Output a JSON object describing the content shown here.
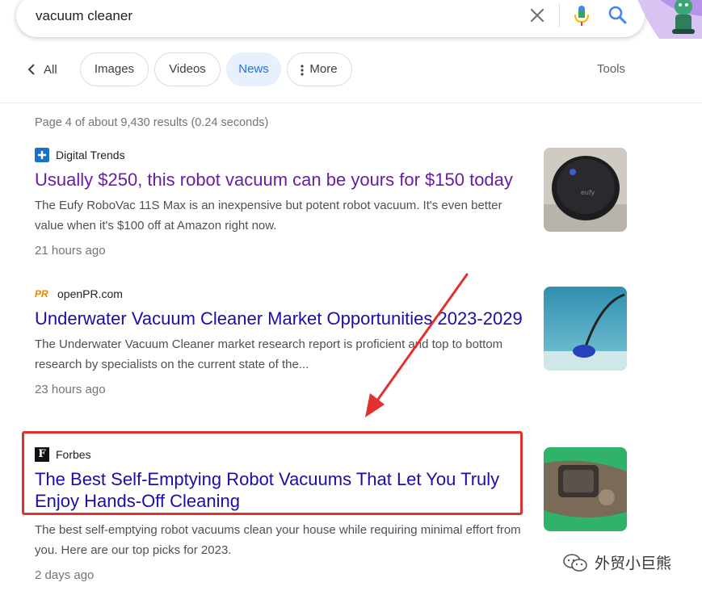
{
  "search": {
    "query": "vacuum cleaner"
  },
  "tabs": {
    "back_label": "All",
    "items": [
      {
        "label": "Images"
      },
      {
        "label": "Videos"
      },
      {
        "label": "News"
      },
      {
        "label": "More"
      }
    ],
    "tools_label": "Tools"
  },
  "stats": "Page 4 of about 9,430 results (0.24 seconds)",
  "results": [
    {
      "source": "Digital Trends",
      "title": "Usually $250, this robot vacuum can be yours for $150 today",
      "snippet": "The Eufy RoboVac 11S Max is an inexpensive but potent robot vacuum. It's even better value when it's $100 off at Amazon right now.",
      "age": "21 hours ago",
      "favicon_text": "+"
    },
    {
      "source": "openPR.com",
      "title": "Underwater Vacuum Cleaner Market Opportunities 2023-2029",
      "snippet": "The Underwater Vacuum Cleaner market research report is proficient and top to bottom research by specialists on the current state of the...",
      "age": "23 hours ago",
      "favicon_text": "PR"
    },
    {
      "source": "Forbes",
      "title": "The Best Self-Emptying Robot Vacuums That Let You Truly Enjoy Hands-Off Cleaning",
      "snippet": "The best self-emptying robot vacuums clean your house while requiring minimal effort from you. Here are our top picks for 2023.",
      "age": "2 days ago",
      "favicon_text": "F"
    }
  ],
  "watermark": "外贸小巨熊",
  "colors": {
    "link": "#1a0dab",
    "visited": "#681da8",
    "highlight": "#e0312f",
    "accent": "#1a73e8"
  }
}
